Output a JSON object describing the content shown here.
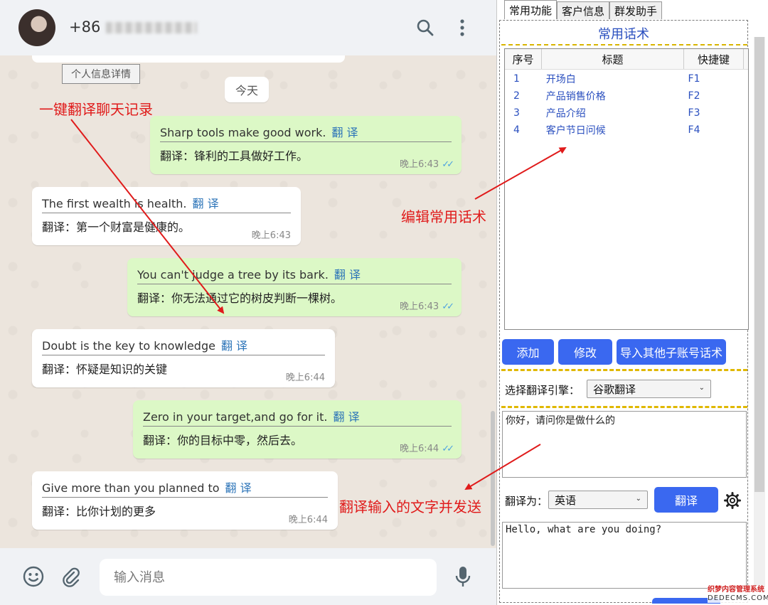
{
  "chat": {
    "contact_prefix": "+86",
    "profile_button": "个人信息详情",
    "date_chip": "今天",
    "translate_link": "翻 译",
    "messages": [
      {
        "dir": "out",
        "text": "Sharp tools make good work.",
        "translation": "翻译：锋利的工具做好工作。",
        "time": "晚上6:43"
      },
      {
        "dir": "in",
        "text": "The first wealth is health.",
        "translation": "翻译：第一个财富是健康的。",
        "time": "晚上6:43"
      },
      {
        "dir": "out",
        "text": "You can't judge a tree by its bark.",
        "translation": "翻译：你无法通过它的树皮判断一棵树。",
        "time": "晚上6:43"
      },
      {
        "dir": "in",
        "text": "Doubt is the key to knowledge",
        "translation": "翻译：怀疑是知识的关键",
        "time": "晚上6:44"
      },
      {
        "dir": "out",
        "text": "Zero in your target,and go for it.",
        "translation": "翻译：你的目标中零，然后去。",
        "time": "晚上6:44"
      },
      {
        "dir": "in",
        "text": "Give more than you planned to",
        "translation": "翻译：比你计划的更多",
        "time": "晚上6:44"
      }
    ],
    "input_placeholder": "输入消息"
  },
  "annotations": {
    "one_click_translate": "一键翻译聊天记录",
    "edit_phrases": "编辑常用话术",
    "translate_send": "翻译输入的文字并发送"
  },
  "panel": {
    "tabs": [
      "常用功能",
      "客户信息",
      "群发助手"
    ],
    "section_title": "常用话术",
    "table": {
      "headers": [
        "序号",
        "标题",
        "快捷键"
      ],
      "rows": [
        [
          "1",
          "开场白",
          "F1"
        ],
        [
          "2",
          "产品销售价格",
          "F2"
        ],
        [
          "3",
          "产品介绍",
          "F3"
        ],
        [
          "4",
          "客户节日问候",
          "F4"
        ]
      ]
    },
    "buttons": {
      "add": "添加",
      "edit": "修改",
      "import": "导入其他子账号话术"
    },
    "engine_label": "选择翻译引擎：",
    "engine_value": "谷歌翻译",
    "source_text": "你好，请问你是做什么的",
    "target_label": "翻译为：",
    "target_value": "英语",
    "translate_button": "翻译",
    "result_text": "Hello, what are you doing?"
  },
  "watermark": {
    "line1": "织梦内容管理系统",
    "line2": "DEDECMS.COM"
  },
  "colors": {
    "outgoing_bubble": "#dcf8c6",
    "incoming_bubble": "#ffffff",
    "accent_blue": "#3a68f0",
    "annotation_red": "#e01b1b"
  },
  "icons": [
    "search-icon",
    "more-vert-icon",
    "emoji-icon",
    "paperclip-icon",
    "microphone-icon",
    "gear-icon",
    "double-check-icon"
  ]
}
